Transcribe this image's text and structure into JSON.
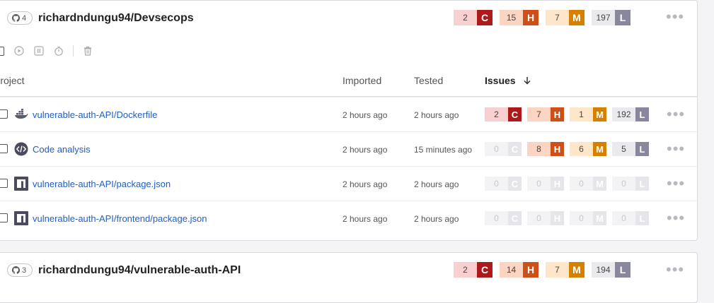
{
  "cards": [
    {
      "repo_count": "4",
      "title": "richardndungu94/Devsecops",
      "severity": {
        "c": "2",
        "h": "15",
        "m": "7",
        "l": "197"
      }
    },
    {
      "repo_count": "3",
      "title": "richardndungu94/vulnerable-auth-API",
      "severity": {
        "c": "2",
        "h": "14",
        "m": "7",
        "l": "194"
      }
    }
  ],
  "letters": {
    "c": "C",
    "h": "H",
    "m": "M",
    "l": "L"
  },
  "table": {
    "col_project": "Project",
    "col_imported": "Imported",
    "col_tested": "Tested",
    "col_issues": "Issues",
    "rows": [
      {
        "icon": "docker-icon",
        "name": "vulnerable-auth-API/Dockerfile",
        "imported": "2 hours ago",
        "tested": "2 hours ago",
        "c": "2",
        "h": "7",
        "m": "1",
        "l": "192"
      },
      {
        "icon": "code-analysis-icon",
        "name": "Code analysis",
        "imported": "2 hours ago",
        "tested": "15 minutes ago",
        "c": "0",
        "h": "8",
        "m": "6",
        "l": "5"
      },
      {
        "icon": "npm-icon",
        "name": "vulnerable-auth-API/package.json",
        "imported": "2 hours ago",
        "tested": "2 hours ago",
        "c": "0",
        "h": "0",
        "m": "0",
        "l": "0"
      },
      {
        "icon": "npm-icon",
        "name": "vulnerable-auth-API/frontend/package.json",
        "imported": "2 hours ago",
        "tested": "2 hours ago",
        "c": "0",
        "h": "0",
        "m": "0",
        "l": "0"
      }
    ]
  },
  "colors": {
    "critical": "#ad1a1a",
    "high": "#ce5019",
    "medium": "#d68000",
    "low": "#88879e",
    "link": "#1f5fc7"
  }
}
